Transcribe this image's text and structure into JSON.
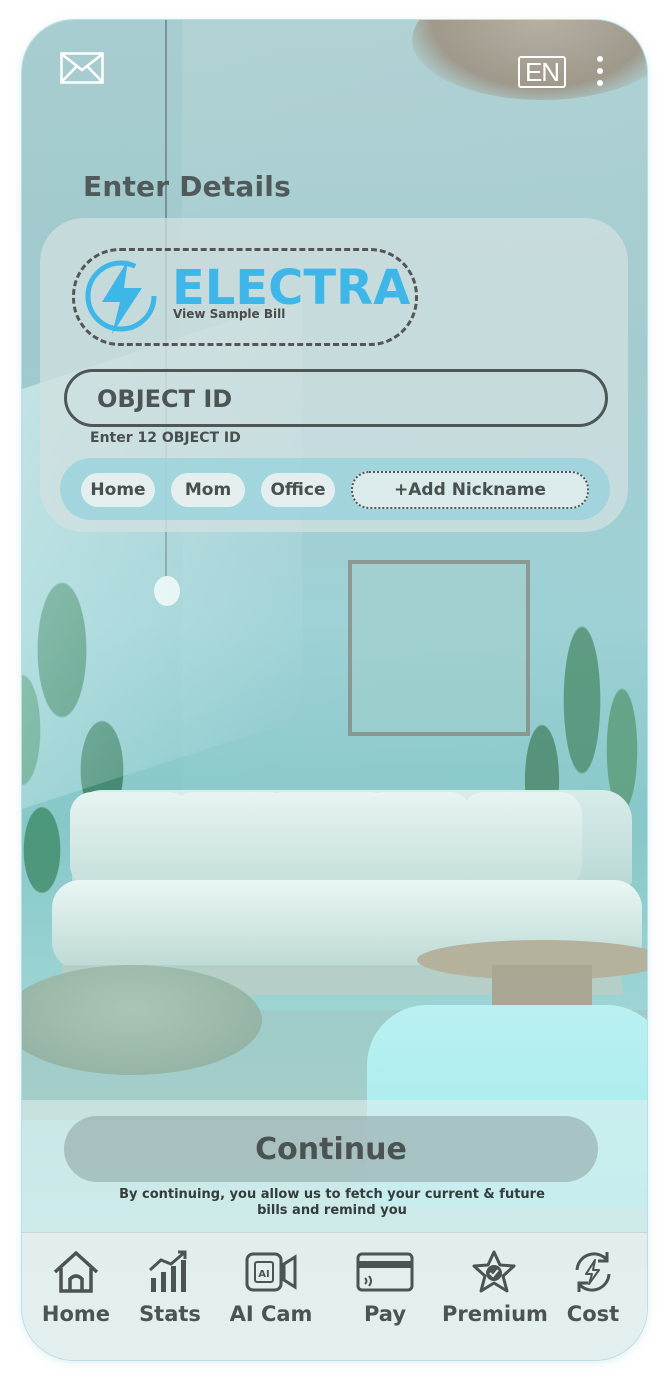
{
  "header": {
    "mail_icon": "mail-icon",
    "language": "EN",
    "menu_icon": "kebab-menu-icon"
  },
  "form": {
    "title": "Enter Details",
    "provider": {
      "name": "ELECTRA",
      "sample_link": "View Sample Bill",
      "logo_icon": "lightning-bolt-icon",
      "brand_color": "#3fb6e8"
    },
    "object_id": {
      "placeholder": "OBJECT ID",
      "value": "",
      "hint": "Enter 12 OBJECT ID"
    },
    "nicknames": [
      "Home",
      "Mom",
      "Office"
    ],
    "add_nickname": "+Add Nickname"
  },
  "footer": {
    "continue_label": "Continue",
    "consent_text": "By continuing, you allow us to fetch your current & future bills and remind you"
  },
  "tabs": [
    {
      "label": "Home",
      "icon": "house-icon"
    },
    {
      "label": "Stats",
      "icon": "bar-chart-icon"
    },
    {
      "label": "AI Cam",
      "icon": "ai-camera-icon"
    },
    {
      "label": "Pay",
      "icon": "card-icon"
    },
    {
      "label": "Premium",
      "icon": "star-badge-icon"
    },
    {
      "label": "Cost",
      "icon": "refresh-bolt-icon"
    }
  ]
}
